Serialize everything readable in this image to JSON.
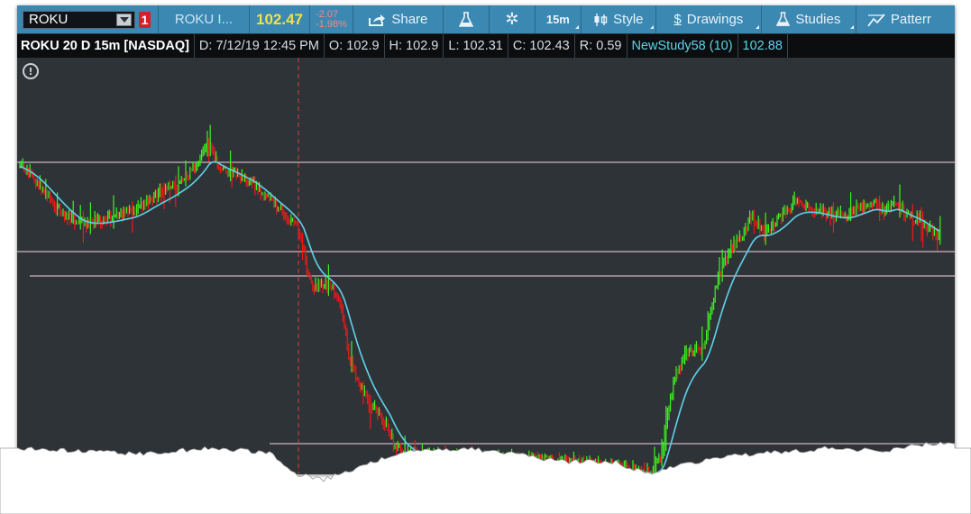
{
  "toolbar": {
    "symbol": "ROKU",
    "alert_count": "1",
    "instrument_name": "ROKU I...",
    "last_price": "102.47",
    "change": "-2.07",
    "change_pct": "-1.98%",
    "share_label": "Share",
    "timeframe_label": "15m",
    "style_label": "Style",
    "drawings_label": "Drawings",
    "studies_label": "Studies",
    "patterns_label": "Patterr"
  },
  "infobar": {
    "title": "ROKU 20 D 15m [NASDAQ]",
    "date": "D: 7/12/19 12:45 PM",
    "open": "O: 102.9",
    "high": "H: 102.9",
    "low": "L: 102.31",
    "close": "C: 102.43",
    "range": "R: 0.59",
    "study_name": "NewStudy58 (10)",
    "study_value": "102.88"
  },
  "colors": {
    "toolbar_bg": "#3b88b3",
    "chart_bg": "#2e3338",
    "up_bar": "#3ef21f",
    "down_bar": "#f01818",
    "study_line": "#5fd3ea",
    "level_line": "#f2d4e4",
    "cursor_line": "#e03a3a",
    "last_price": "#f4e142"
  },
  "icons": [
    "dropdown-arrow-icon",
    "share-icon",
    "flask-icon",
    "gear-icon",
    "candlestick-icon",
    "dollar-drawing-icon",
    "studies-flask-icon",
    "pattern-icon",
    "alert-info-icon"
  ]
}
